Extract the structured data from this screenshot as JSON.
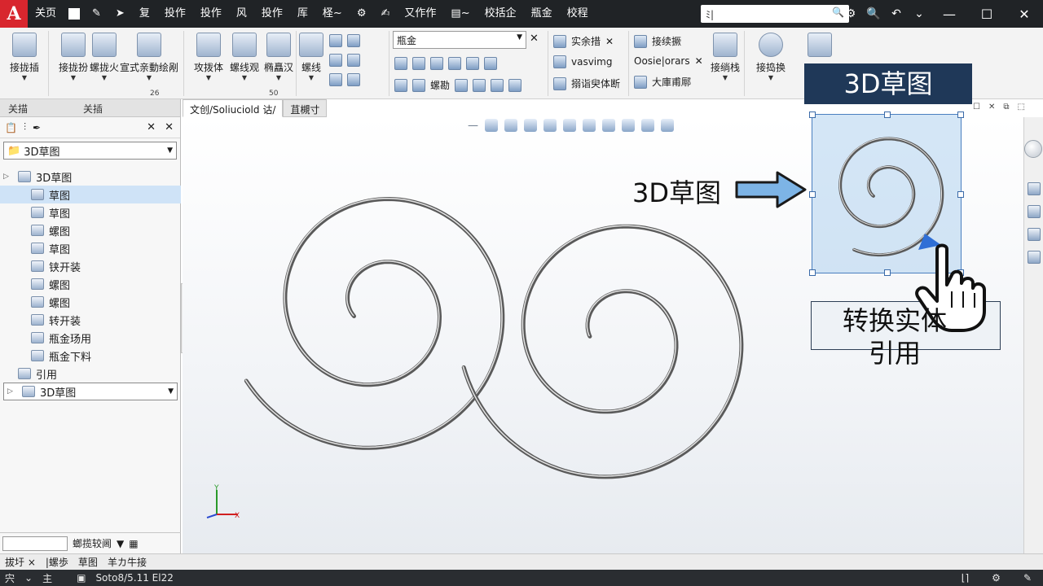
{
  "titlebar": {
    "logo": "A",
    "menus": [
      "关页",
      "复",
      "投作",
      "投作",
      "风",
      "投作",
      "厍",
      "柽~",
      "又作作",
      "校括企",
      "瓶金",
      "校程"
    ],
    "search_value": "ﾐ|",
    "win_controls": [
      "—",
      "☐",
      "✕"
    ]
  },
  "ribbon": {
    "big_buttons": [
      "接拢插",
      "接拢扮",
      "螺拢火",
      "宣式亲動绘剐",
      "攻拨体",
      "螺线观",
      "椭矗汉",
      "螺线",
      "接绱栈",
      "接捣换"
    ],
    "combo_value": "瓶金",
    "small_items": [
      "实余措",
      "vasvimg",
      "搦诣臾体断",
      "接续撅",
      "Oosie|orars",
      "大庫甫鄏",
      "螺勘"
    ],
    "group_numbers": [
      "26",
      "50"
    ]
  },
  "left_panel": {
    "tabs": [
      "关描",
      "关插"
    ],
    "dropdown": "3D草图",
    "tree": [
      {
        "label": "3D草图",
        "toggle": "▷"
      },
      {
        "label": "草图",
        "selected": true
      },
      {
        "label": "草图"
      },
      {
        "label": "螺图"
      },
      {
        "label": "草图"
      },
      {
        "label": "铗开装"
      },
      {
        "label": "螺图"
      },
      {
        "label": "螺图"
      },
      {
        "label": "转开装"
      },
      {
        "label": "瓶金玚用"
      },
      {
        "label": "瓶金下料"
      },
      {
        "label": "引用"
      }
    ],
    "tree_bottom": "3D草图",
    "bottom_combo": "螂揽较阃"
  },
  "doc_tabs": [
    "文创/Soliuciold 诂/",
    "苴槻寸"
  ],
  "annotations": {
    "title_callout": "3D草图",
    "arrow_label": "3D草图",
    "command_line1": "转换实体",
    "command_line2": "引用"
  },
  "sheet_tabs": [
    "拔圩 ×",
    "|螺歩",
    "草图",
    "羊カ牛接"
  ],
  "status": {
    "left": [
      "宍",
      "主"
    ],
    "file": "Soto8/5.11 El22"
  },
  "colors": {
    "titlebar": "#202326",
    "accent": "#1f3858",
    "selection": "#b0d1ee",
    "logo": "#d8262e"
  }
}
